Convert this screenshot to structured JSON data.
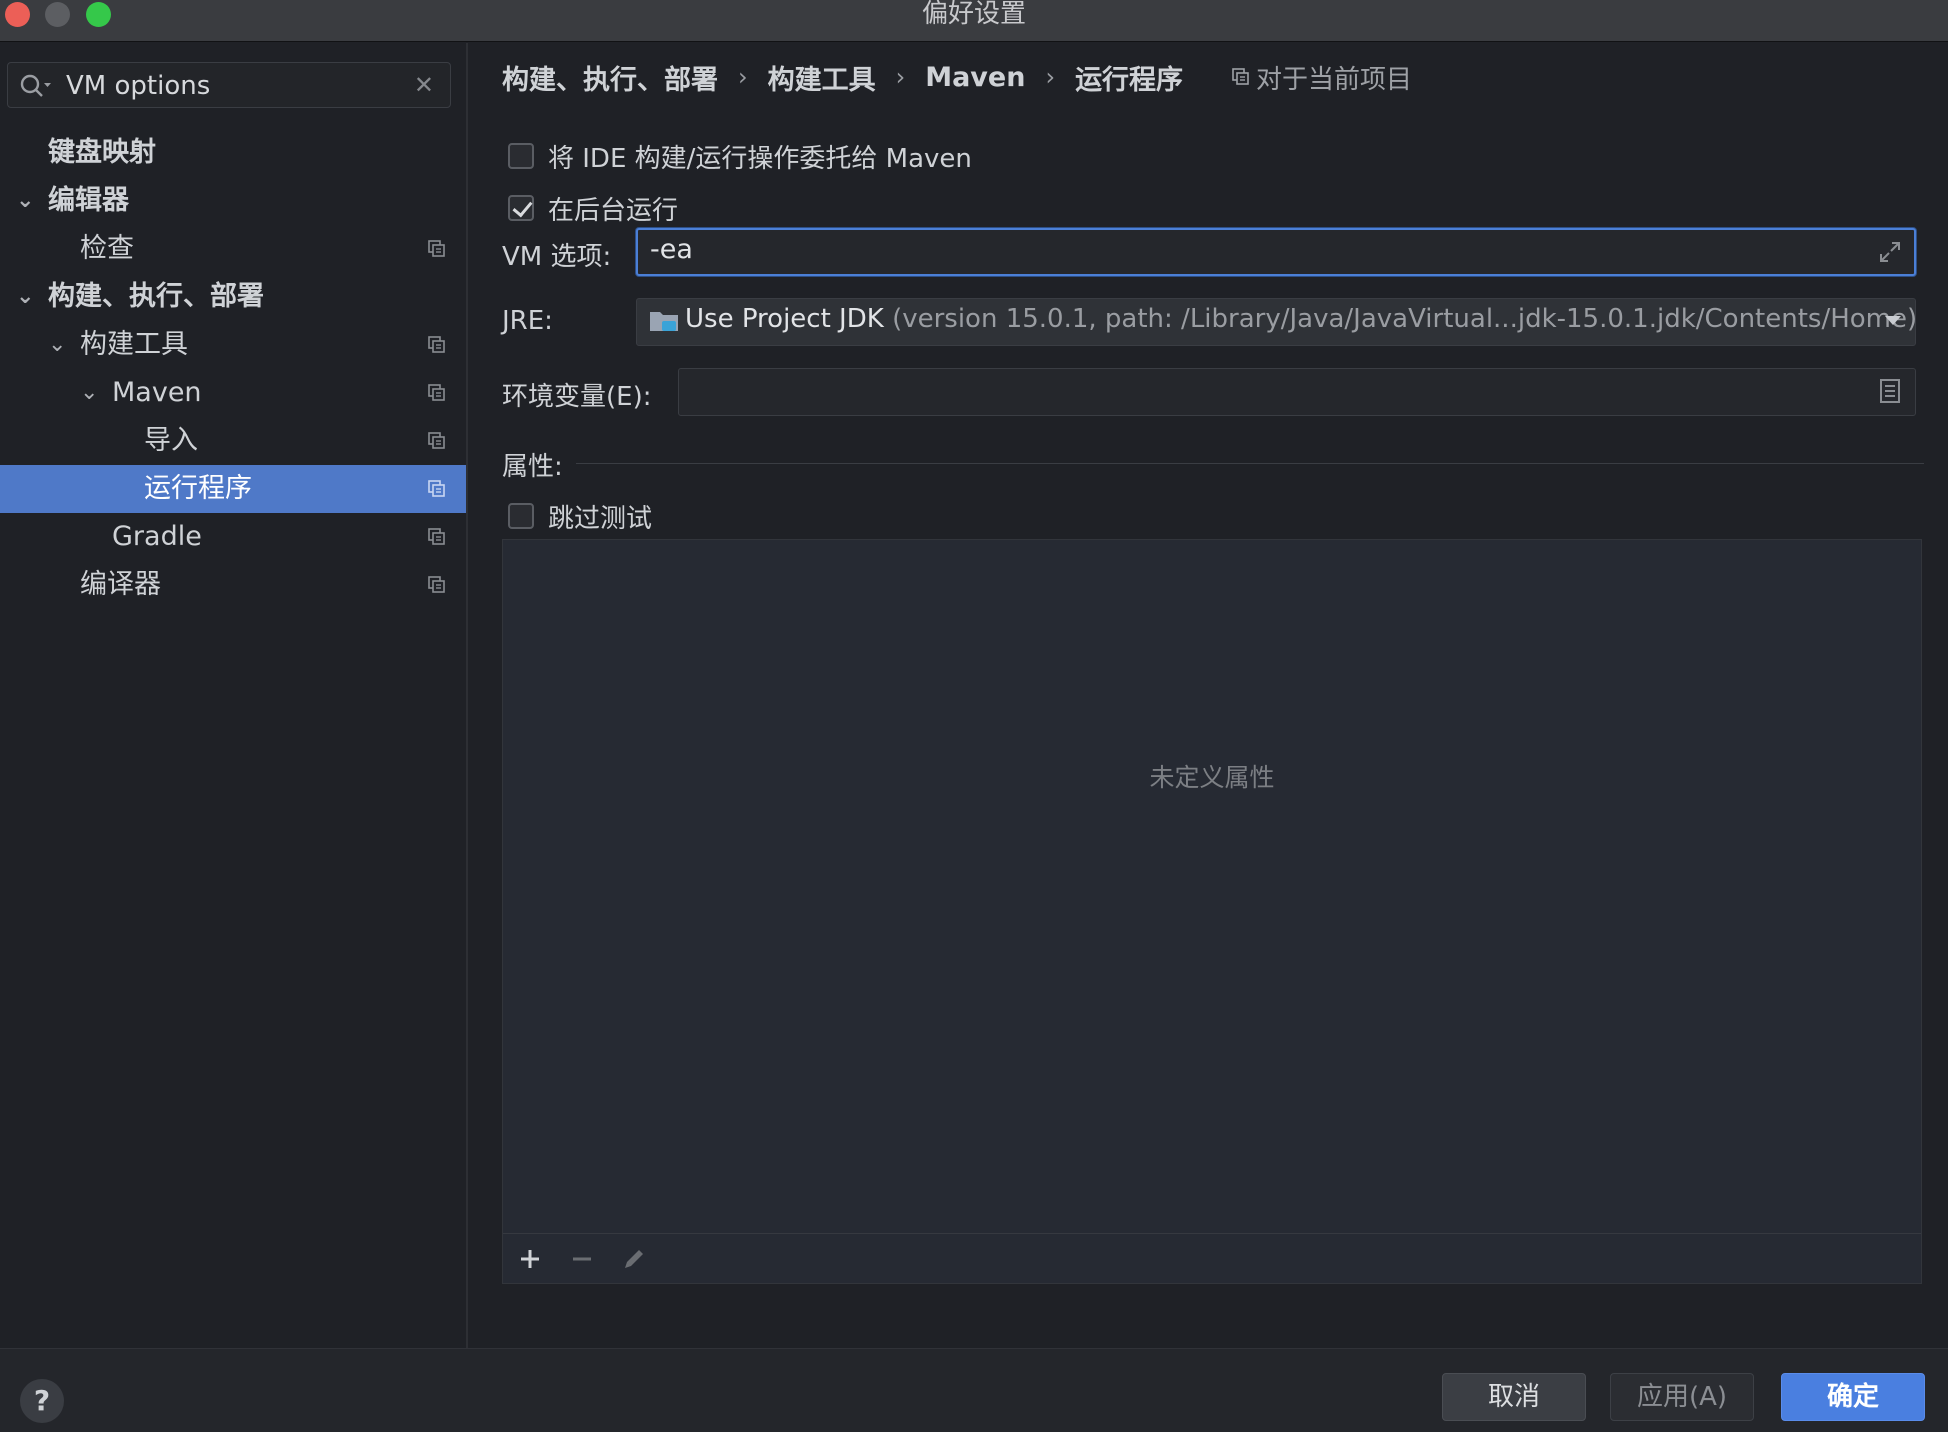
{
  "window": {
    "title": "偏好设置"
  },
  "sidebar": {
    "search": {
      "value": "VM options",
      "clear": "✕"
    },
    "tree": [
      {
        "label": "键盘映射",
        "chevron": ""
      },
      {
        "label": "编辑器",
        "chevron": "⌄"
      },
      {
        "label": "检查",
        "chevron": ""
      },
      {
        "label": "构建、执行、部署",
        "chevron": "⌄"
      },
      {
        "label": "构建工具",
        "chevron": "⌄"
      },
      {
        "label": "Maven",
        "chevron": "⌄"
      },
      {
        "label": "导入",
        "chevron": ""
      },
      {
        "label": "运行程序",
        "chevron": ""
      },
      {
        "label": "Gradle",
        "chevron": ""
      },
      {
        "label": "编译器",
        "chevron": ""
      }
    ]
  },
  "main": {
    "breadcrumb": [
      "构建、执行、部署",
      "构建工具",
      "Maven",
      "运行程序"
    ],
    "breadcrumb_sep": "›",
    "scope_label": "对于当前项目",
    "delegate_checkbox": {
      "label": "将 IDE 构建/运行操作委托给 Maven",
      "checked": false
    },
    "background_checkbox": {
      "label": "在后台运行",
      "checked": true
    },
    "vm_options": {
      "label": "VM 选项:",
      "value": "-ea"
    },
    "jre": {
      "label": "JRE:",
      "value": "Use Project JDK",
      "detail": "(version 15.0.1, path: /Library/Java/JavaVirtual...jdk-15.0.1.jdk/Contents/Home)"
    },
    "env": {
      "label": "环境变量(E):",
      "value": ""
    },
    "properties": {
      "label": "属性:",
      "skip_tests": {
        "label": "跳过测试",
        "checked": false
      },
      "empty_text": "未定义属性"
    }
  },
  "footer": {
    "help": "?",
    "cancel": "取消",
    "apply": "应用(A)",
    "ok": "确定"
  },
  "colors": {
    "accent": "#4a7fe0",
    "selection": "#4f79c8",
    "background": "#1f2126"
  }
}
